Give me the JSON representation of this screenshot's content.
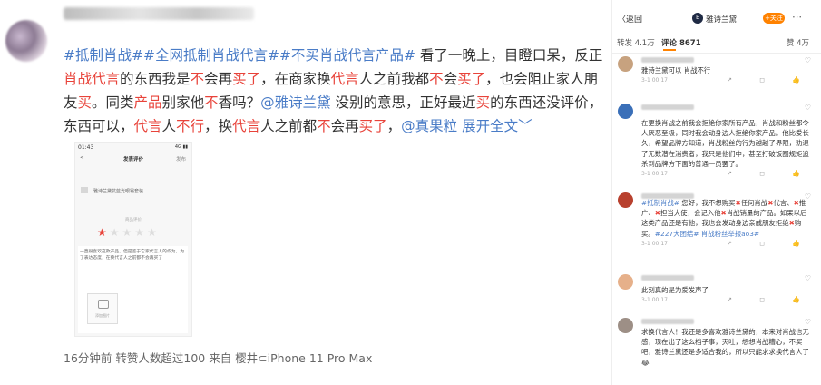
{
  "post": {
    "text_parts": [
      {
        "t": "#抵制肖战##全网抵制肖战代言##不买肖战代言产品#",
        "c": "blue"
      },
      {
        "t": " 看了一晚上，目瞪口呆，反正",
        "c": ""
      },
      {
        "t": "肖战代言",
        "c": "red"
      },
      {
        "t": "的东西我是",
        "c": ""
      },
      {
        "t": "不",
        "c": "red"
      },
      {
        "t": "会再",
        "c": ""
      },
      {
        "t": "买了",
        "c": "red"
      },
      {
        "t": "，在商家换",
        "c": ""
      },
      {
        "t": "代言",
        "c": "red"
      },
      {
        "t": "人之前我都",
        "c": ""
      },
      {
        "t": "不",
        "c": "red"
      },
      {
        "t": "会",
        "c": ""
      },
      {
        "t": "买了",
        "c": "red"
      },
      {
        "t": "，也会阻止家人朋友",
        "c": ""
      },
      {
        "t": "买",
        "c": "red"
      },
      {
        "t": "。同类",
        "c": ""
      },
      {
        "t": "产品",
        "c": "red"
      },
      {
        "t": "别家他",
        "c": ""
      },
      {
        "t": "不",
        "c": "red"
      },
      {
        "t": "香吗？",
        "c": ""
      },
      {
        "t": "@雅诗兰黛",
        "c": "blue"
      },
      {
        "t": " 没别的意思，正好最近",
        "c": ""
      },
      {
        "t": "买",
        "c": "red"
      },
      {
        "t": "的东西还没评价，东西可以，",
        "c": ""
      },
      {
        "t": "代言",
        "c": "red"
      },
      {
        "t": "人",
        "c": ""
      },
      {
        "t": "不行",
        "c": "red"
      },
      {
        "t": "，换",
        "c": ""
      },
      {
        "t": "代言",
        "c": "red"
      },
      {
        "t": "人之前都",
        "c": ""
      },
      {
        "t": "不",
        "c": "red"
      },
      {
        "t": "会再",
        "c": ""
      },
      {
        "t": "买了",
        "c": "red"
      },
      {
        "t": "，",
        "c": ""
      },
      {
        "t": "@真果粒",
        "c": "blue"
      },
      {
        "t": " ",
        "c": ""
      },
      {
        "t": "展开全文",
        "c": "blue"
      },
      {
        "t": "﹀",
        "c": "blue"
      }
    ],
    "meta": "16分钟前  转赞人数超过100  来自 樱井⊂iPhone 11 Pro Max",
    "screenshot": {
      "time": "01:43",
      "status": "4G ▮▮",
      "back": "<",
      "title": "发表评价",
      "publish": "发布",
      "product": "雅诗兰黛抗蓝光眼霜套装",
      "rate_label": "商品评价",
      "stars": [
        "★",
        "★",
        "★",
        "★",
        "★"
      ],
      "rating": 1,
      "review": "一直很喜欢这款产品，但是鉴于它家代言人的作为，为了表达态度，在换代言人之前都不会再买了",
      "photo_label": "添加图片"
    }
  },
  "panel": {
    "back": "〈返回",
    "brand_logo": "E",
    "brand_name": "雅诗兰黛",
    "follow": "+关注",
    "more": "⋯",
    "tabs": {
      "forward": "转发 4.1万",
      "comment": "评论 8671",
      "like": "赞 4万"
    },
    "comments": [
      {
        "text": [
          {
            "t": "雅诗兰黛可以 肖战不行",
            "c": ""
          }
        ],
        "time": "3-1 00:17",
        "avatar_color": "#c7a27f"
      },
      {
        "text": [
          {
            "t": "在更换肖战之前我会拒绝你家所有产品，肖战和粉丝都令人厌恶至极，同时我会动身边人拒绝你家产品。他比爱长久，希望品牌方知道，肖战粉丝的行为越越了界限，劝退了无数潜在消费者，我只是他们中，甚至打破饭圈规矩追杀到品牌方下面的普通一员罢了。",
            "c": ""
          }
        ],
        "time": "3-1 00:17",
        "avatar_color": "#3a6fb8"
      },
      {
        "text": [
          {
            "t": "#抵制肖战#",
            "c": "blue"
          },
          {
            "t": " 您好，我不想购买",
            "c": ""
          },
          {
            "t": "✖",
            "c": "x"
          },
          {
            "t": "任何肖战",
            "c": ""
          },
          {
            "t": "✖",
            "c": "x"
          },
          {
            "t": "代言、",
            "c": ""
          },
          {
            "t": "✖",
            "c": "x"
          },
          {
            "t": "推广、",
            "c": ""
          },
          {
            "t": "✖",
            "c": "x"
          },
          {
            "t": "担当大使，会记入他",
            "c": ""
          },
          {
            "t": "✖",
            "c": "x"
          },
          {
            "t": "肖战销量的产品。如果以后这类产品还是有他，我也会发动身边亲戚朋友拒绝",
            "c": ""
          },
          {
            "t": "✖",
            "c": "x"
          },
          {
            "t": "购买。",
            "c": ""
          },
          {
            "t": "#227大团结# 肖战粉丝举报ao3#",
            "c": "blue"
          }
        ],
        "time": "3-1 00:17",
        "avatar_color": "#b8402e"
      },
      {
        "text": [
          {
            "t": "此刻真的是为爱发声了",
            "c": ""
          }
        ],
        "time": "3-1 00:17",
        "avatar_color": "#e6b08a"
      },
      {
        "text": [
          {
            "t": "求换代言人！我还是多喜欢雅诗兰黛的，本来对肖战也无感，现在出了这么档子事，灭吐，想想肖战糟心，不买吧，雅诗兰黛还是多适合我的，所以只能求求换代言人了 😂",
            "c": ""
          }
        ],
        "time": "",
        "avatar_color": "#9d8f86"
      }
    ],
    "actions": "↗ ◻ 👍"
  }
}
